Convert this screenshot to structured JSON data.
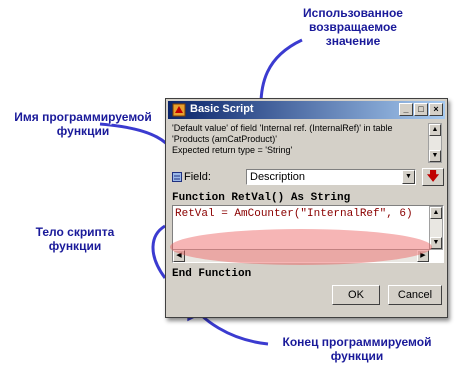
{
  "annotations": {
    "return_value": [
      "Использованное",
      "возвращаемое",
      "значение"
    ],
    "function_name": [
      "Имя программируемой",
      "функции"
    ],
    "function_body": [
      "Тело скрипта",
      "функции"
    ],
    "function_end": [
      "Конец программируемой",
      "функции"
    ]
  },
  "colors": {
    "callout_text": "#1a1a9a",
    "titlebar": "#0a246a",
    "highlight": "#eb5a5a"
  },
  "window": {
    "title": "Basic Script",
    "controls": {
      "minimize": "_",
      "maximize": "□",
      "close": "×"
    },
    "description": [
      "'Default value' of field 'Internal ref. (InternalRef)' in table",
      "'Products (amCatProduct)'",
      "Expected return type = 'String'"
    ],
    "field_label": "Field:",
    "field_value": "Description",
    "function_header": "Function RetVal() As String",
    "code_line": "RetVal = AmCounter(\"InternalRef\", 6)",
    "function_end": "End Function",
    "ok_label": "OK",
    "cancel_label": "Cancel",
    "icons": [
      "app-icon",
      "field-icon",
      "dropdown-arrow-icon",
      "red-down-arrow-icon"
    ]
  }
}
